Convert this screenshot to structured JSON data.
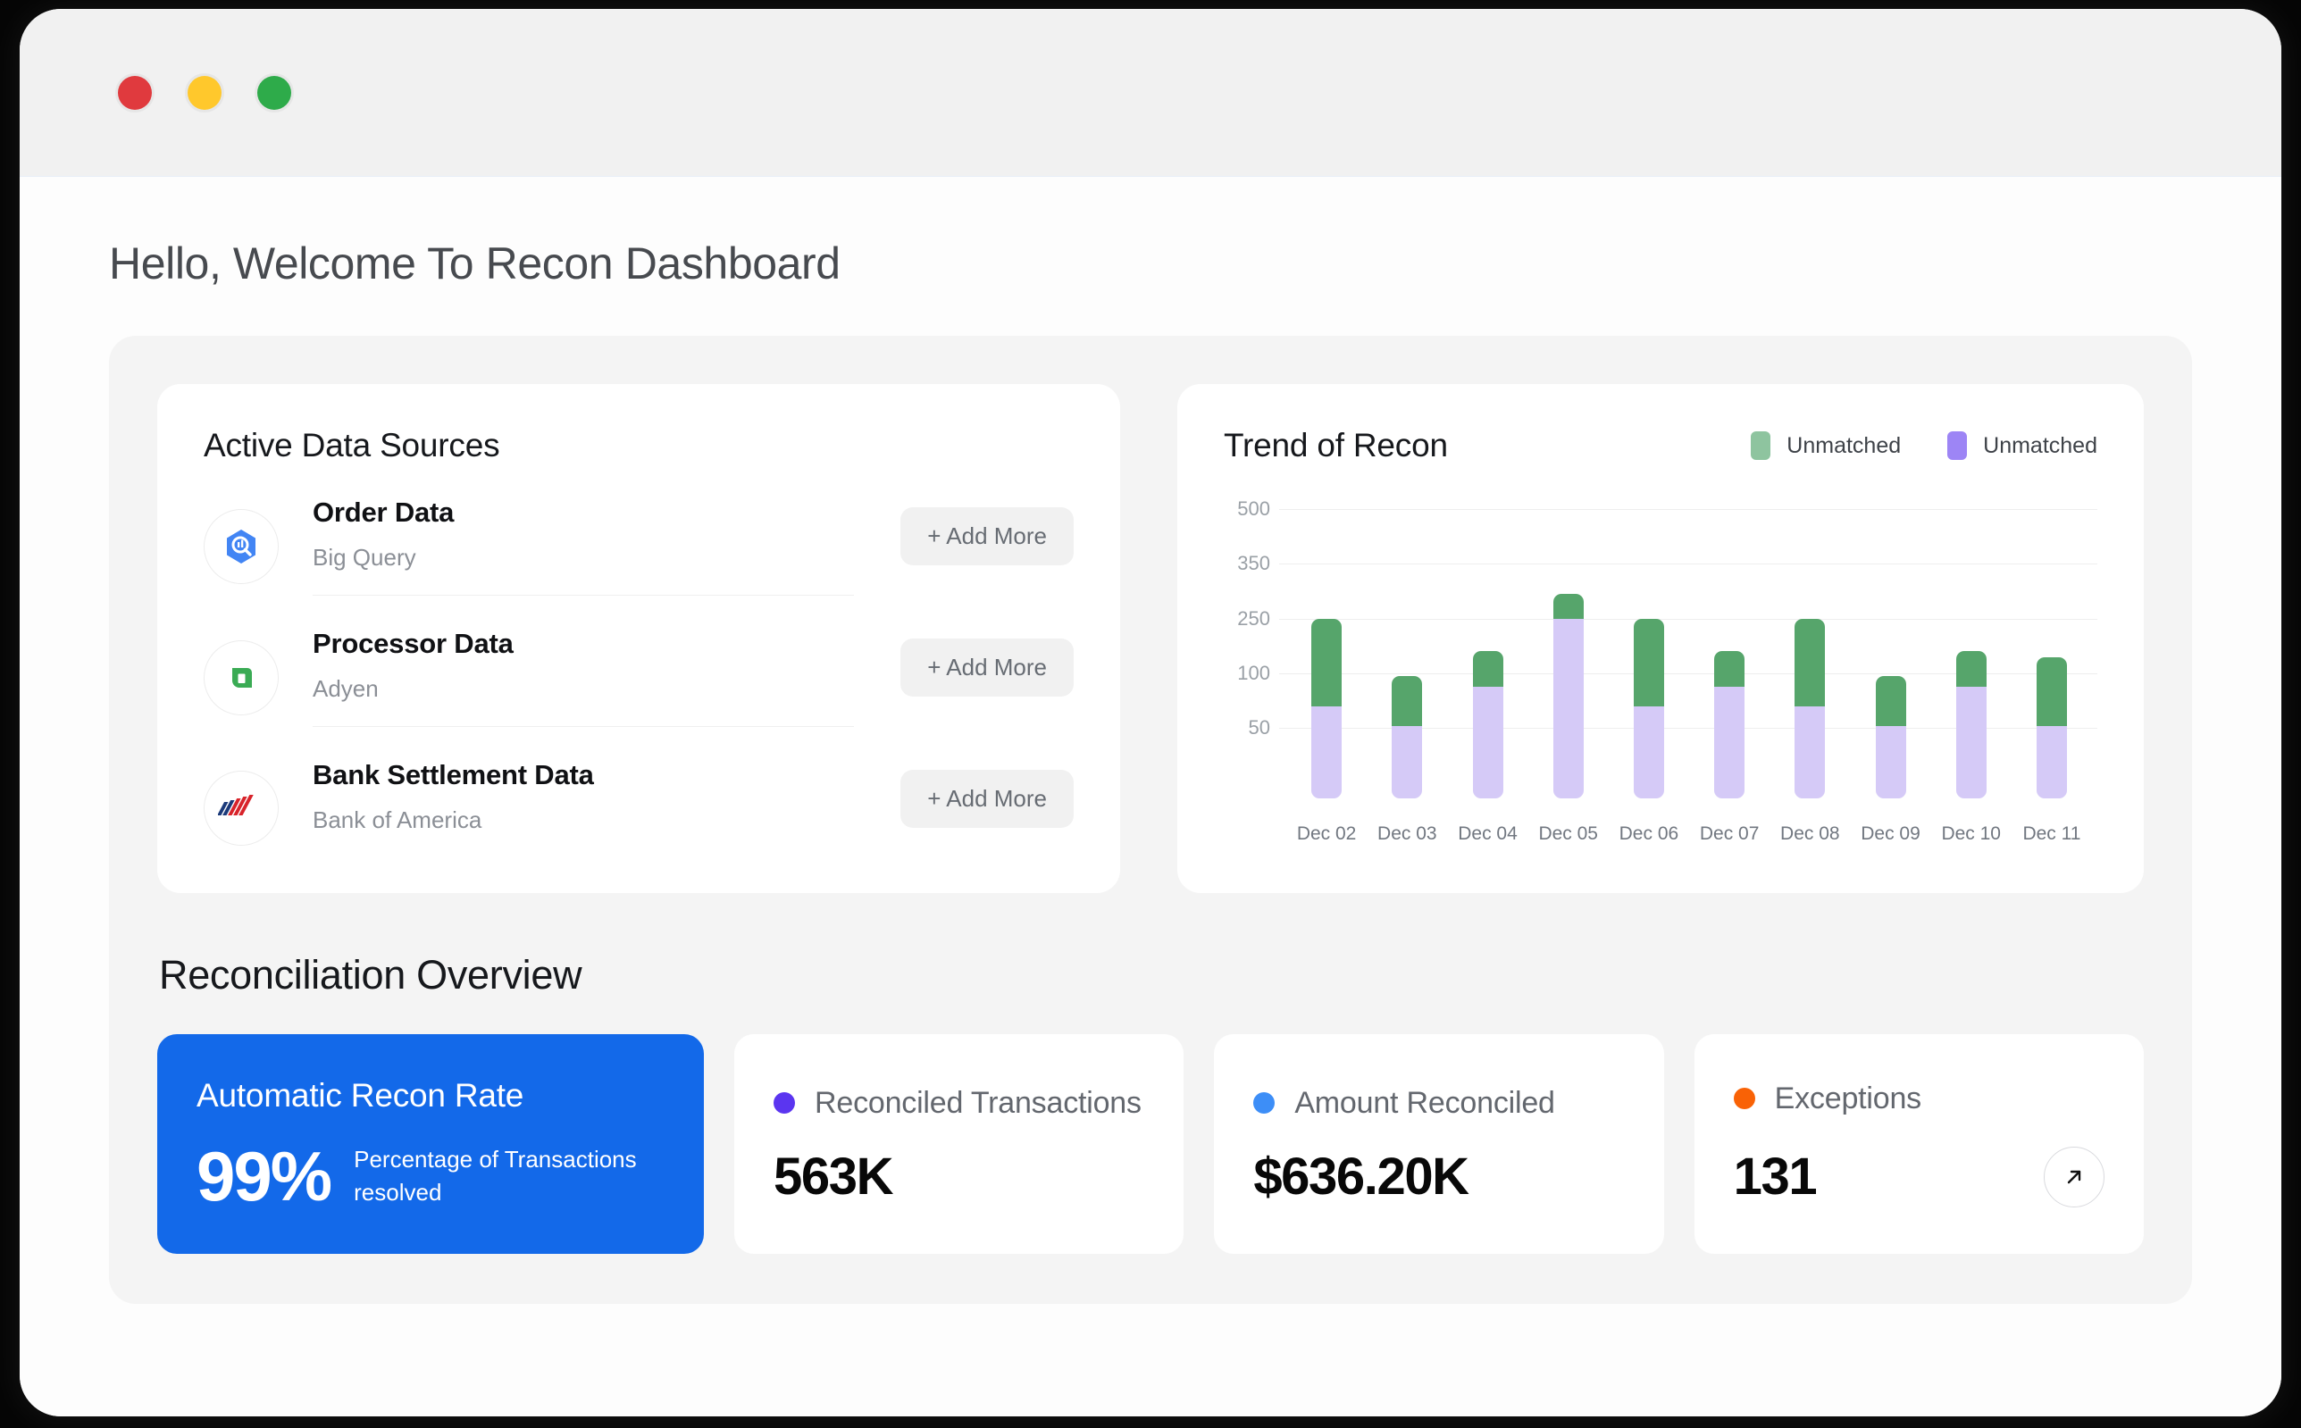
{
  "window": {
    "traffic_lights": [
      "close",
      "minimize",
      "zoom"
    ],
    "colors": {
      "close": "#e03a3e",
      "minimize": "#ffc82c",
      "zoom": "#2eab4a"
    }
  },
  "page_title": "Hello, Welcome To Recon Dashboard",
  "sources": {
    "title": "Active Data Sources",
    "items": [
      {
        "icon": "bigquery-icon",
        "name": "Order Data",
        "subtitle": "Big Query",
        "action": "+ Add More"
      },
      {
        "icon": "adyen-icon",
        "name": "Processor Data",
        "subtitle": "Adyen",
        "action": "+ Add More"
      },
      {
        "icon": "bank-of-america-icon",
        "name": "Bank Settlement Data",
        "subtitle": "Bank of America",
        "action": "+ Add More"
      }
    ]
  },
  "chart_card": {
    "title": "Trend of Recon",
    "legend": [
      {
        "label": "Unmatched",
        "color": "#8ec49f"
      },
      {
        "label": "Unmatched",
        "color": "#9d85f5"
      }
    ]
  },
  "chart_data": {
    "type": "bar",
    "title": "Trend of Recon",
    "xlabel": "",
    "ylabel": "",
    "stacked": true,
    "grid": true,
    "legend_position": "top-right",
    "ylim": [
      0,
      500
    ],
    "ytick_labels": [
      "500",
      "350",
      "250",
      "100",
      "50"
    ],
    "ytick_values": [
      500,
      350,
      250,
      100,
      50
    ],
    "categories": [
      "Dec 02",
      "Dec 03",
      "Dec 04",
      "Dec 05",
      "Dec 06",
      "Dec 07",
      "Dec 08",
      "Dec 09",
      "Dec 10",
      "Dec 11"
    ],
    "series": [
      {
        "name": "Unmatched",
        "color": "#d5caf7",
        "values": [
          70,
          52,
          88,
          250,
          70,
          88,
          70,
          52,
          88,
          52
        ]
      },
      {
        "name": "Unmatched",
        "color": "#56a56b",
        "values": [
          180,
          45,
          72,
          45,
          180,
          72,
          180,
          45,
          72,
          91
        ]
      }
    ],
    "totals": [
      250,
      97,
      160,
      295,
      250,
      160,
      250,
      97,
      160,
      143
    ]
  },
  "overview": {
    "title": "Reconciliation Overview",
    "primary": {
      "title": "Automatic Recon Rate",
      "value": "99%",
      "description": "Percentage of Transactions resolved",
      "color": "#1369e9"
    },
    "metrics": [
      {
        "label": "Reconciled Transactions",
        "value": "563K",
        "dot_color": "#5b35f0",
        "has_arrow": false
      },
      {
        "label": "Amount Reconciled",
        "value": "$636.20K",
        "dot_color": "#3d8ef7",
        "has_arrow": false
      },
      {
        "label": "Exceptions",
        "value": "131",
        "dot_color": "#f96206",
        "has_arrow": true,
        "arrow_icon": "arrow-up-right-icon"
      }
    ]
  }
}
